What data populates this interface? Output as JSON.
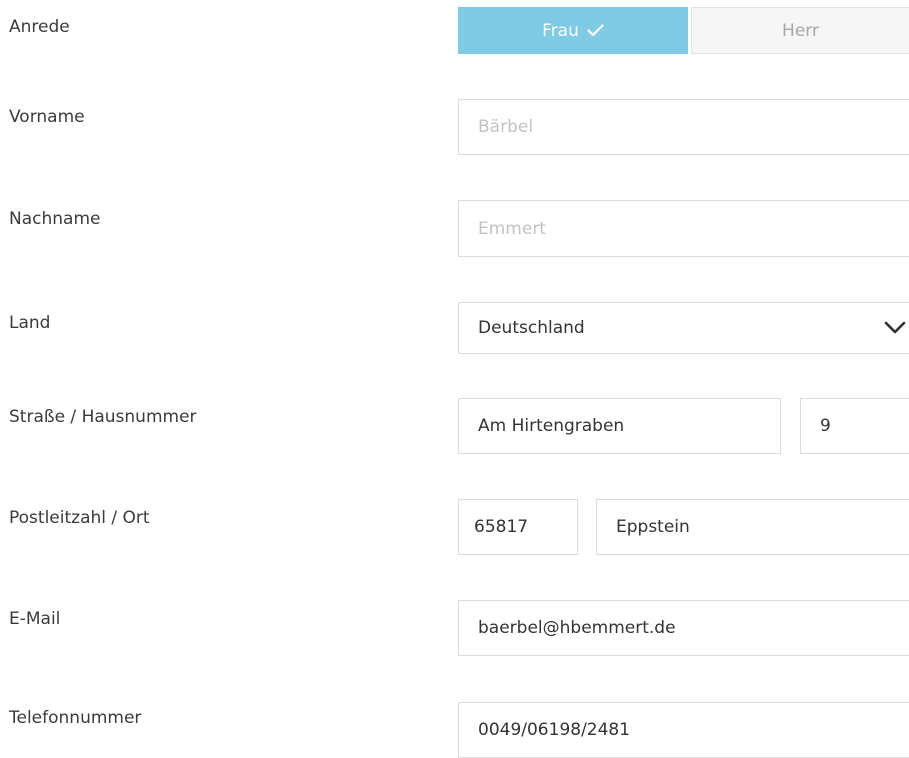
{
  "form": {
    "anrede": {
      "label": "Anrede",
      "options": [
        "Frau",
        "Herr"
      ],
      "selected": "Frau"
    },
    "vorname": {
      "label": "Vorname",
      "placeholder": "Bärbel"
    },
    "nachname": {
      "label": "Nachname",
      "placeholder": "Emmert"
    },
    "land": {
      "label": "Land",
      "value": "Deutschland"
    },
    "strasse": {
      "label": "Straße / Hausnummer",
      "street_value": "Am Hirtengraben",
      "number_value": "9"
    },
    "ort": {
      "label": "Postleitzahl / Ort",
      "zip_value": "65817",
      "city_value": "Eppstein"
    },
    "email": {
      "label": "E-Mail",
      "value": "baerbel@hbemmert.de"
    },
    "telefon": {
      "label": "Telefonnummer",
      "value": "0049/06198/2481"
    }
  },
  "colors": {
    "active_toggle": "#7fcbe6",
    "inactive_toggle": "#f6f6f6",
    "field_border": "#dcdcdc",
    "placeholder_text": "#c2c2c2"
  },
  "icons": {
    "selected_marker": "check-icon",
    "dropdown": "chevron-down-icon"
  }
}
